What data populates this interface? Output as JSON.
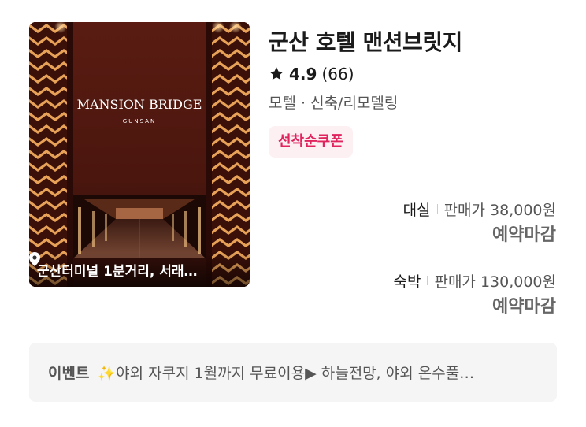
{
  "listing": {
    "image": {
      "sign_main": "MANSION BRIDGE",
      "sign_sub": "GUNSAN",
      "location": "군산터미널 1분거리, 서래…",
      "location_icon": "map-pin-icon"
    },
    "title": "군산 호텔 맨션브릿지",
    "rating": {
      "icon": "star-icon",
      "score": "4.9",
      "count": "(66)"
    },
    "category": "모텔 · 신축/리모델링",
    "coupon": "선착순쿠폰",
    "rooms": [
      {
        "type": "대실",
        "price": "판매가 38,000원",
        "status": "예약마감"
      },
      {
        "type": "숙박",
        "price": "판매가 130,000원",
        "status": "예약마감"
      }
    ],
    "event": {
      "label": "이벤트",
      "text": "✨야외 자쿠지 1월까지 무료이용▶ 하늘전망, 야외 온수풀…"
    }
  },
  "colors": {
    "coupon_bg": "#fdf0f3",
    "coupon_text": "#e0245e",
    "event_bg": "#f5f5f5",
    "status_gray": "#666666"
  }
}
